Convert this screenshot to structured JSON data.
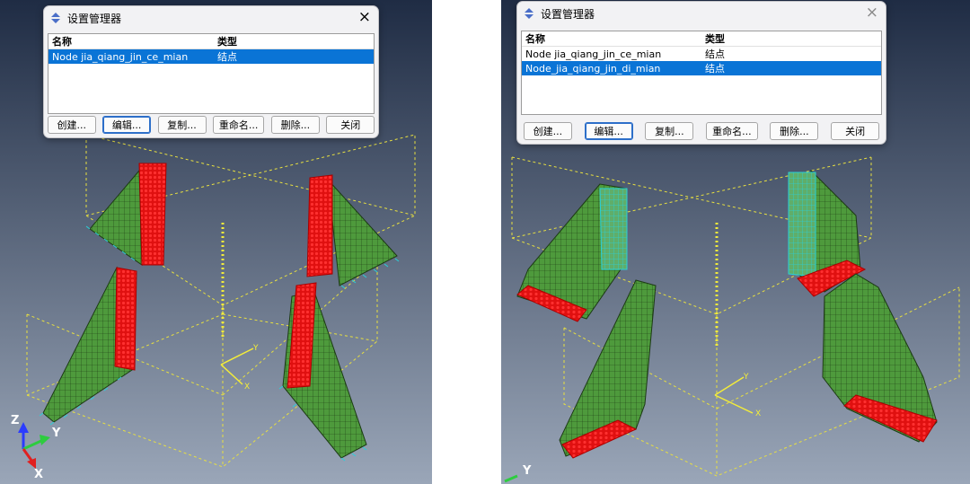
{
  "left": {
    "dialog": {
      "title": "设置管理器",
      "close": "×",
      "columns": [
        "名称",
        "类型"
      ],
      "rows": [
        {
          "name": "Node jia_qiang_jin_ce_mian",
          "type": "结点",
          "selected": true
        }
      ],
      "buttons": [
        "创建...",
        "编辑...",
        "复制...",
        "重命名...",
        "删除...",
        "关闭"
      ]
    },
    "axes": {
      "z": "Z",
      "y": "Y",
      "x": "X"
    },
    "csys": {
      "y": "Y",
      "x": "X"
    }
  },
  "right": {
    "dialog": {
      "title": "设置管理器",
      "close": "×",
      "columns": [
        "名称",
        "类型"
      ],
      "rows": [
        {
          "name": "Node jia_qiang_jin_ce_mian",
          "type": "结点",
          "selected": false
        },
        {
          "name": "Node_jia_qiang_jin_di_mian",
          "type": "结点",
          "selected": true
        }
      ],
      "buttons": [
        "创建...",
        "编辑...",
        "复制...",
        "重命名...",
        "删除...",
        "关闭"
      ]
    },
    "axes": {
      "y": "Y"
    },
    "csys": {
      "y": "Y",
      "x": "X"
    }
  },
  "colors": {
    "viewport_top": "#1f2c44",
    "viewport_bottom": "#9aa6b8",
    "mesh_green": "#4e9a3c",
    "mesh_line": "#1c3a14",
    "node_red": "#ff1a1a",
    "node_cyan": "#2ad0d8",
    "construction_yellow": "#e8e040",
    "selection_blue": "#0a74d6"
  }
}
